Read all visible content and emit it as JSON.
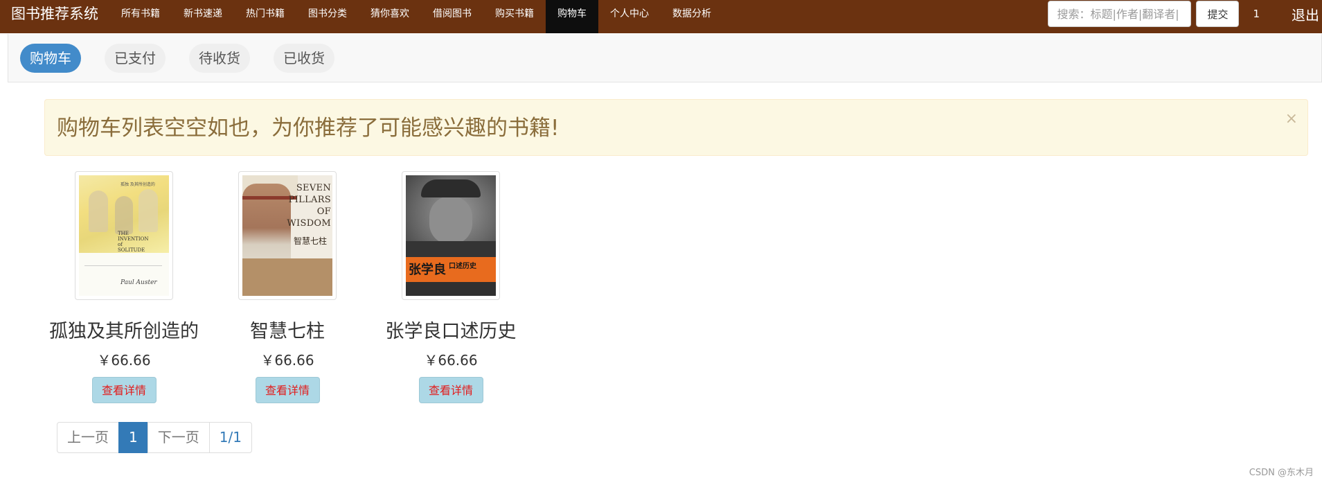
{
  "navbar": {
    "brand": "图书推荐系统",
    "items": [
      {
        "label": "所有书籍"
      },
      {
        "label": "新书速递"
      },
      {
        "label": "热门书籍"
      },
      {
        "label": "图书分类"
      },
      {
        "label": "猜你喜欢"
      },
      {
        "label": "借阅图书"
      },
      {
        "label": "购买书籍"
      },
      {
        "label": "购物车",
        "active": true
      },
      {
        "label": "个人中心"
      },
      {
        "label": "数据分析"
      }
    ],
    "search_placeholder": "搜索：标题|作者|翻译者|",
    "submit_label": "提交",
    "user_count": "1",
    "logout_label": "退出"
  },
  "tabs": [
    {
      "label": "购物车",
      "active": true
    },
    {
      "label": "已支付"
    },
    {
      "label": "待收货"
    },
    {
      "label": "已收货"
    }
  ],
  "alert": {
    "message": "购物车列表空空如也，为你推荐了可能感兴趣的书籍!",
    "close": "×"
  },
  "books": [
    {
      "title": "孤独及其所创造的",
      "price": "￥66.66",
      "detail_label": "查看详情",
      "cover_text": {
        "cn": "孤独 及其所创造的",
        "en1": "THE",
        "en2": "INVENTION",
        "en3": "of",
        "en4": "SOLITUDE",
        "sig": "Paul Auster"
      }
    },
    {
      "title": "智慧七柱",
      "price": "￥66.66",
      "detail_label": "查看详情",
      "cover_text": {
        "en1": "SEVEN",
        "en2": "PILLARS",
        "en3": "OF",
        "en4": "WISDOM",
        "cn": "智慧七柱"
      }
    },
    {
      "title": "张学良口述历史",
      "price": "￥66.66",
      "detail_label": "查看详情",
      "cover_text": {
        "t1": "张学良",
        "t2": "口述历史"
      }
    }
  ],
  "pagination": {
    "prev": "上一页",
    "current": "1",
    "next": "下一页",
    "total": "1/1"
  },
  "watermark": "CSDN @东木月"
}
